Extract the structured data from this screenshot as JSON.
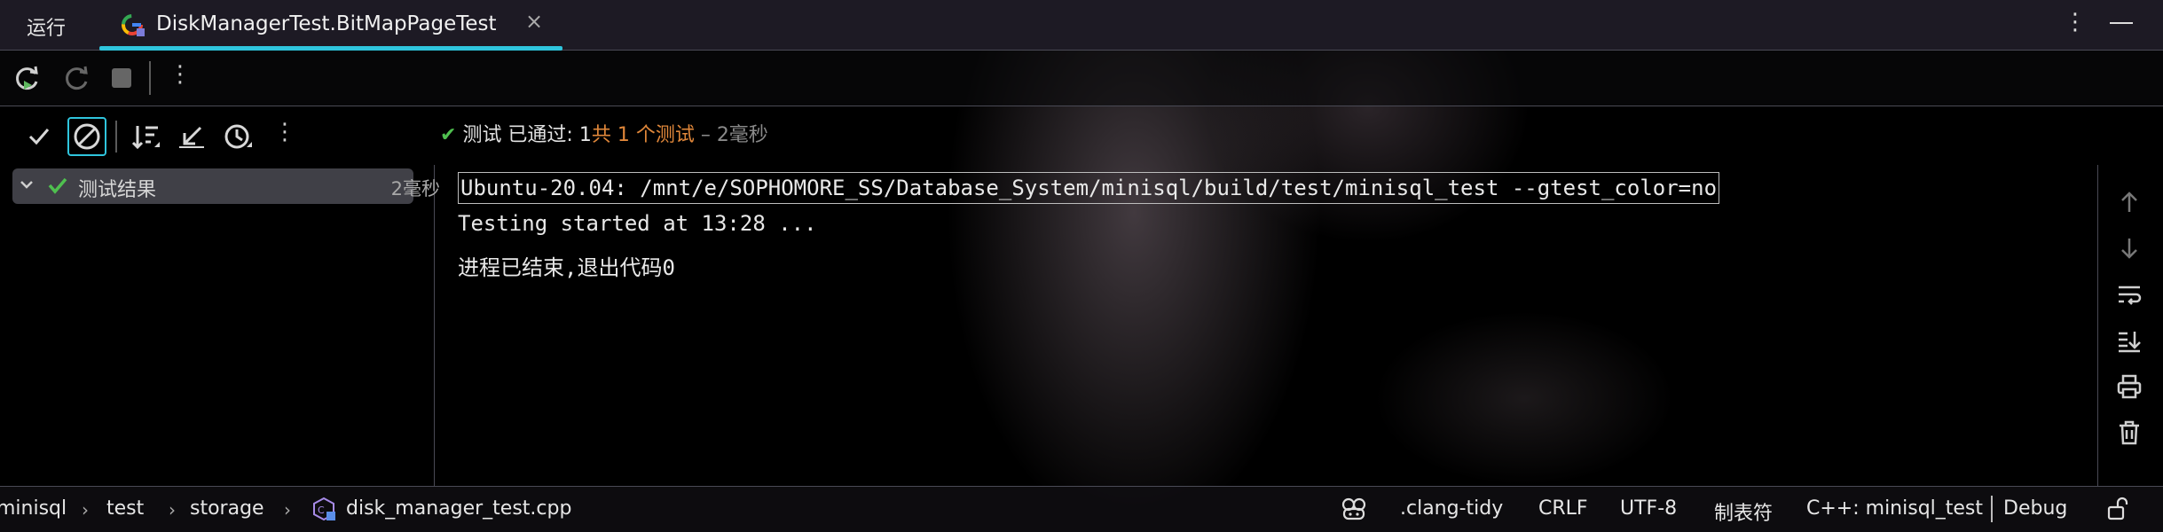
{
  "tabbar": {
    "run_label": "运行",
    "tab_title": "DiskManagerTest.BitMapPageTest",
    "close_glyph": "×",
    "more_glyph": "⋮"
  },
  "toolbar2": {
    "status_check": "✔",
    "status_passed": "测试 已通过: 1",
    "status_total": "共 1 个测试",
    "status_time": " – 2毫秒"
  },
  "tree": {
    "label": "测试结果",
    "time": "2毫秒"
  },
  "console": {
    "lines": [
      "Ubuntu-20.04: /mnt/e/SOPHOMORE_SS/Database_System/minisql/build/test/minisql_test --gtest_color=no",
      "Testing started at 13:28 ...",
      "进程已结束,退出代码0"
    ]
  },
  "statusbar": {
    "breadcrumbs": [
      "minisql",
      "test",
      "storage",
      "disk_manager_test.cpp"
    ],
    "clang_tidy": ".clang-tidy",
    "line_ending": "CRLF",
    "encoding": "UTF-8",
    "indent": "制表符",
    "context": "C++: minisql_test",
    "config": "Debug"
  },
  "colors": {
    "accent": "#2fc5dd",
    "pass_green": "#4fc04f",
    "orange": "#e0873a"
  }
}
